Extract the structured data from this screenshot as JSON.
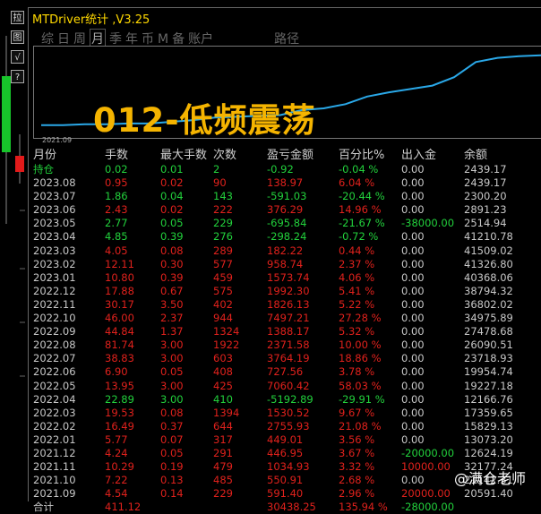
{
  "window": {
    "title": "MTDriver统计 ,V3.25"
  },
  "toolbar": [
    {
      "label": "拉",
      "name": "toolbar-button-1"
    },
    {
      "label": "图",
      "name": "toolbar-button-2"
    },
    {
      "label": "√",
      "name": "toolbar-button-3"
    },
    {
      "label": "?",
      "name": "toolbar-button-4"
    }
  ],
  "tabs": [
    {
      "label": "综"
    },
    {
      "label": "日"
    },
    {
      "label": "周"
    },
    {
      "label": "月",
      "selected": true
    },
    {
      "label": "季"
    },
    {
      "label": "年"
    },
    {
      "label": "币"
    },
    {
      "label": "M"
    },
    {
      "label": "备"
    },
    {
      "label": "账户"
    },
    {
      "label": "路径",
      "gap": true
    }
  ],
  "chart": {
    "overlay_text": "012-低频震荡",
    "start_date": "2021.09",
    "line_color": "#2aa8e8",
    "equity": [
      0.13,
      0.13,
      0.14,
      0.14,
      0.15,
      0.15,
      0.17,
      0.19,
      0.22,
      0.23,
      0.24,
      0.25,
      0.31,
      0.33,
      0.38,
      0.47,
      0.52,
      0.56,
      0.6,
      0.7,
      0.88,
      0.93,
      0.95,
      0.96
    ]
  },
  "table": {
    "headers": [
      "月份",
      "手数",
      "最大手数",
      "次数",
      "盈亏金额",
      "百分比%",
      "出入金",
      "余额"
    ],
    "rows": [
      {
        "c": [
          "持仓",
          "0.02",
          "0.01",
          "2",
          "-0.92",
          "-0.04 %",
          "0.00",
          "2439.17"
        ],
        "k": [
          "gr",
          "gr",
          "gr",
          "gr",
          "gr",
          "gr",
          "wt",
          "wt"
        ]
      },
      {
        "c": [
          "2023.08",
          "0.95",
          "0.02",
          "90",
          "138.97",
          "6.04 %",
          "0.00",
          "2439.17"
        ],
        "k": [
          "wt",
          "rd",
          "rd",
          "rd",
          "rd",
          "rd",
          "wt",
          "wt"
        ]
      },
      {
        "c": [
          "2023.07",
          "1.86",
          "0.04",
          "143",
          "-591.03",
          "-20.44 %",
          "0.00",
          "2300.20"
        ],
        "k": [
          "wt",
          "gr",
          "gr",
          "gr",
          "gr",
          "gr",
          "wt",
          "wt"
        ]
      },
      {
        "c": [
          "2023.06",
          "2.43",
          "0.02",
          "222",
          "376.29",
          "14.96 %",
          "0.00",
          "2891.23"
        ],
        "k": [
          "wt",
          "rd",
          "rd",
          "rd",
          "rd",
          "rd",
          "wt",
          "wt"
        ]
      },
      {
        "c": [
          "2023.05",
          "2.77",
          "0.05",
          "229",
          "-695.84",
          "-21.67 %",
          "-38000.00",
          "2514.94"
        ],
        "k": [
          "wt",
          "gr",
          "gr",
          "gr",
          "gr",
          "gr",
          "gr",
          "wt"
        ]
      },
      {
        "c": [
          "2023.04",
          "4.85",
          "0.39",
          "276",
          "-298.24",
          "-0.72 %",
          "0.00",
          "41210.78"
        ],
        "k": [
          "wt",
          "gr",
          "gr",
          "gr",
          "gr",
          "gr",
          "wt",
          "wt"
        ]
      },
      {
        "c": [
          "2023.03",
          "4.05",
          "0.08",
          "289",
          "182.22",
          "0.44 %",
          "0.00",
          "41509.02"
        ],
        "k": [
          "wt",
          "rd",
          "rd",
          "rd",
          "rd",
          "rd",
          "wt",
          "wt"
        ]
      },
      {
        "c": [
          "2023.02",
          "12.11",
          "0.30",
          "577",
          "958.74",
          "2.37 %",
          "0.00",
          "41326.80"
        ],
        "k": [
          "wt",
          "rd",
          "rd",
          "rd",
          "rd",
          "rd",
          "wt",
          "wt"
        ]
      },
      {
        "c": [
          "2023.01",
          "10.80",
          "0.39",
          "459",
          "1573.74",
          "4.06 %",
          "0.00",
          "40368.06"
        ],
        "k": [
          "wt",
          "rd",
          "rd",
          "rd",
          "rd",
          "rd",
          "wt",
          "wt"
        ]
      },
      {
        "c": [
          "2022.12",
          "17.88",
          "0.67",
          "575",
          "1992.30",
          "5.41 %",
          "0.00",
          "38794.32"
        ],
        "k": [
          "wt",
          "rd",
          "rd",
          "rd",
          "rd",
          "rd",
          "wt",
          "wt"
        ]
      },
      {
        "c": [
          "2022.11",
          "30.17",
          "3.50",
          "402",
          "1826.13",
          "5.22 %",
          "0.00",
          "36802.02"
        ],
        "k": [
          "wt",
          "rd",
          "rd",
          "rd",
          "rd",
          "rd",
          "wt",
          "wt"
        ]
      },
      {
        "c": [
          "2022.10",
          "46.00",
          "2.37",
          "944",
          "7497.21",
          "27.28 %",
          "0.00",
          "34975.89"
        ],
        "k": [
          "wt",
          "rd",
          "rd",
          "rd",
          "rd",
          "rd",
          "wt",
          "wt"
        ]
      },
      {
        "c": [
          "2022.09",
          "44.84",
          "1.37",
          "1324",
          "1388.17",
          "5.32 %",
          "0.00",
          "27478.68"
        ],
        "k": [
          "wt",
          "rd",
          "rd",
          "rd",
          "rd",
          "rd",
          "wt",
          "wt"
        ]
      },
      {
        "c": [
          "2022.08",
          "81.74",
          "3.00",
          "1922",
          "2371.58",
          "10.00 %",
          "0.00",
          "26090.51"
        ],
        "k": [
          "wt",
          "rd",
          "rd",
          "rd",
          "rd",
          "rd",
          "wt",
          "wt"
        ]
      },
      {
        "c": [
          "2022.07",
          "38.83",
          "3.00",
          "603",
          "3764.19",
          "18.86 %",
          "0.00",
          "23718.93"
        ],
        "k": [
          "wt",
          "rd",
          "rd",
          "rd",
          "rd",
          "rd",
          "wt",
          "wt"
        ]
      },
      {
        "c": [
          "2022.06",
          "6.90",
          "0.05",
          "408",
          "727.56",
          "3.78 %",
          "0.00",
          "19954.74"
        ],
        "k": [
          "wt",
          "rd",
          "rd",
          "rd",
          "rd",
          "rd",
          "wt",
          "wt"
        ]
      },
      {
        "c": [
          "2022.05",
          "13.95",
          "3.00",
          "425",
          "7060.42",
          "58.03 %",
          "0.00",
          "19227.18"
        ],
        "k": [
          "wt",
          "rd",
          "rd",
          "rd",
          "rd",
          "rd",
          "wt",
          "wt"
        ]
      },
      {
        "c": [
          "2022.04",
          "22.89",
          "3.00",
          "410",
          "-5192.89",
          "-29.91 %",
          "0.00",
          "12166.76"
        ],
        "k": [
          "wt",
          "gr",
          "gr",
          "gr",
          "gr",
          "gr",
          "wt",
          "wt"
        ]
      },
      {
        "c": [
          "2022.03",
          "19.53",
          "0.08",
          "1394",
          "1530.52",
          "9.67 %",
          "0.00",
          "17359.65"
        ],
        "k": [
          "wt",
          "rd",
          "rd",
          "rd",
          "rd",
          "rd",
          "wt",
          "wt"
        ]
      },
      {
        "c": [
          "2022.02",
          "16.49",
          "0.37",
          "644",
          "2755.93",
          "21.08 %",
          "0.00",
          "15829.13"
        ],
        "k": [
          "wt",
          "rd",
          "rd",
          "rd",
          "rd",
          "rd",
          "wt",
          "wt"
        ]
      },
      {
        "c": [
          "2022.01",
          "5.77",
          "0.07",
          "317",
          "449.01",
          "3.56 %",
          "0.00",
          "13073.20"
        ],
        "k": [
          "wt",
          "rd",
          "rd",
          "rd",
          "rd",
          "rd",
          "wt",
          "wt"
        ]
      },
      {
        "c": [
          "2021.12",
          "4.24",
          "0.05",
          "291",
          "446.95",
          "3.67 %",
          "-20000.00",
          "12624.19"
        ],
        "k": [
          "wt",
          "rd",
          "rd",
          "rd",
          "rd",
          "rd",
          "gr",
          "wt"
        ]
      },
      {
        "c": [
          "2021.11",
          "10.29",
          "0.19",
          "479",
          "1034.93",
          "3.32 %",
          "10000.00",
          "32177.24"
        ],
        "k": [
          "wt",
          "rd",
          "rd",
          "rd",
          "rd",
          "rd",
          "rd",
          "wt"
        ]
      },
      {
        "c": [
          "2021.10",
          "7.22",
          "0.13",
          "485",
          "550.91",
          "2.68 %",
          "0.00",
          "21142.31"
        ],
        "k": [
          "wt",
          "rd",
          "rd",
          "rd",
          "rd",
          "rd",
          "wt",
          "wt"
        ]
      },
      {
        "c": [
          "2021.09",
          "4.54",
          "0.14",
          "229",
          "591.40",
          "2.96 %",
          "20000.00",
          "20591.40"
        ],
        "k": [
          "wt",
          "rd",
          "rd",
          "rd",
          "rd",
          "rd",
          "rd",
          "wt"
        ]
      }
    ],
    "total": {
      "c": [
        "合计",
        "411.12",
        "",
        "",
        "30438.25",
        "135.94 %",
        "-28000.00",
        ""
      ],
      "k": [
        "wt",
        "rd",
        "wt",
        "wt",
        "rd",
        "rd",
        "gr",
        "wt"
      ]
    }
  },
  "watermark": "@满仓老师"
}
